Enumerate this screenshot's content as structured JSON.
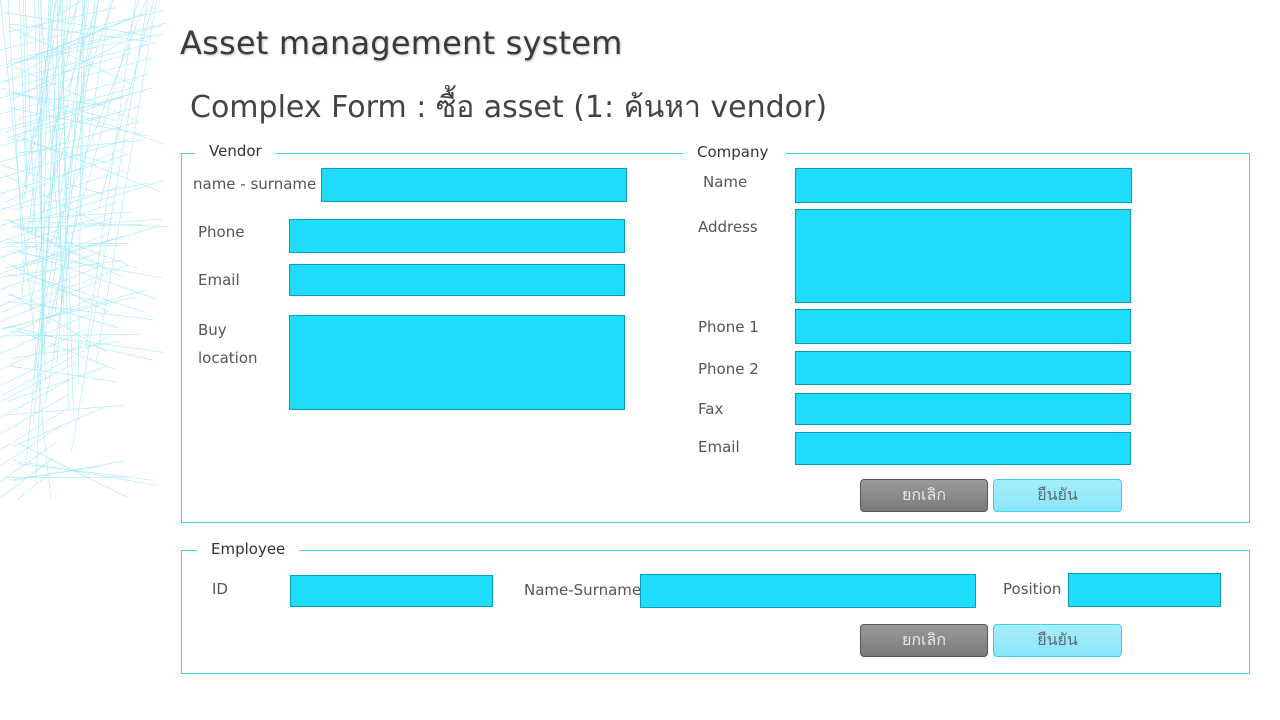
{
  "header": {
    "app_title": "Asset management system",
    "page_title": "Complex Form : ซื้อ asset (1: ค้นหา vendor)"
  },
  "vendor": {
    "legend": "Vendor",
    "name_label": "name - surname",
    "phone_label": "Phone",
    "email_label": "Email",
    "buy_location_label_line1": "Buy",
    "buy_location_label_line2": "location",
    "name_value": "",
    "phone_value": "",
    "email_value": "",
    "buy_location_value": ""
  },
  "company": {
    "legend": "Company",
    "name_label": "Name",
    "address_label": "Address",
    "phone1_label": "Phone 1",
    "phone2_label": "Phone 2",
    "fax_label": "Fax",
    "email_label": "Email",
    "name_value": "",
    "address_value": "",
    "phone1_value": "",
    "phone2_value": "",
    "fax_value": "",
    "email_value": "",
    "cancel_label": "ยกเลิก",
    "confirm_label": "ยืนยัน"
  },
  "employee": {
    "legend": "Employee",
    "id_label": "ID",
    "name_label": "Name-Surname",
    "position_label": "Position",
    "id_value": "",
    "name_value": "",
    "position_value": "",
    "cancel_label": "ยกเลิก",
    "confirm_label": "ยืนยัน"
  },
  "colors": {
    "field_fill": "#1fdcfb",
    "panel_border": "#3fd0e8",
    "cancel_button": "#8a8a8a",
    "confirm_button": "#98eafb"
  }
}
